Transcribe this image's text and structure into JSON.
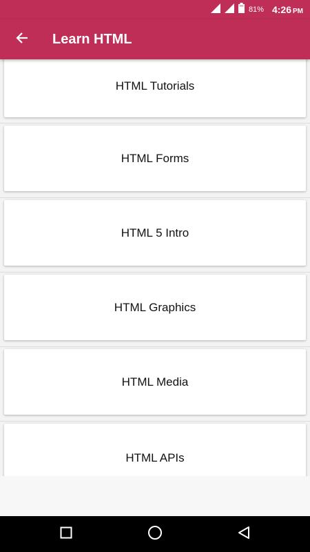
{
  "status_bar": {
    "battery_percent": "81%",
    "time": "4:26",
    "ampm": "PM",
    "icons": [
      "signal-icon",
      "signal-icon",
      "battery-icon"
    ]
  },
  "app_bar": {
    "title": "Learn HTML",
    "back_icon": "arrow-back-icon",
    "color": "#be2e57"
  },
  "list": {
    "items": [
      {
        "label": "HTML Tutorials"
      },
      {
        "label": "HTML Forms"
      },
      {
        "label": "HTML 5 Intro"
      },
      {
        "label": "HTML Graphics"
      },
      {
        "label": "HTML Media"
      },
      {
        "label": "HTML APIs"
      }
    ]
  },
  "nav_bar": {
    "buttons": [
      "recent-apps-icon",
      "home-icon",
      "back-triangle-icon"
    ]
  }
}
